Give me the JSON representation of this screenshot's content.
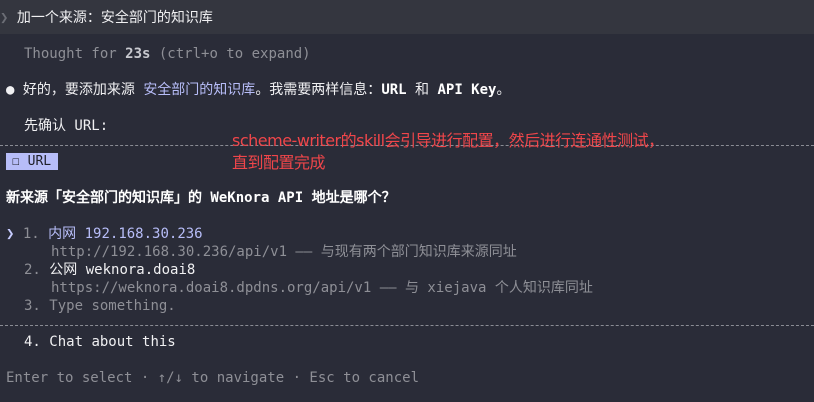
{
  "prompt": {
    "chevron": "❯",
    "text": "加一个来源：安全部门的知识库"
  },
  "thought": {
    "prefix": "Thought for ",
    "duration": "23s",
    "suffix": " (ctrl+o to expand)"
  },
  "reply": {
    "bullet": "●",
    "part1": "好的，要添加来源 ",
    "source_name": "安全部门的知识库",
    "part2": "。我需要两样信息：",
    "url_label": "URL",
    "and": " 和 ",
    "key_label": "API Key",
    "end": "。"
  },
  "confirm_text": "先确认 URL:",
  "tab": {
    "checkbox": "☐",
    "label": "URL"
  },
  "annotation": {
    "line1": "scheme-writer的skill会引导进行配置，然后进行连通性测试，",
    "line2": "直到配置完成"
  },
  "question": "新来源「安全部门的知识库」的 WeKnora API 地址是哪个？",
  "options": [
    {
      "cursor": "❯",
      "number": "1.",
      "title": "内网 192.168.30.236",
      "description": "http://192.168.30.236/api/v1 —— 与现有两个部门知识库来源同址"
    },
    {
      "cursor": "",
      "number": "2.",
      "title": "公网 weknora.doai8",
      "description": "https://weknora.doai8.dpdns.org/api/v1 —— 与 xiejava 个人知识库同址"
    },
    {
      "cursor": "",
      "number": "3.",
      "title": "Type something."
    }
  ],
  "chat_option": {
    "number": "4.",
    "title": "Chat about this"
  },
  "footer": "Enter to select · ↑/↓ to navigate · Esc to cancel",
  "colors": {
    "background": "#2a2c38",
    "accent": "#b7bdf8",
    "annotation": "#f0464a",
    "dim": "#8e8f96"
  }
}
